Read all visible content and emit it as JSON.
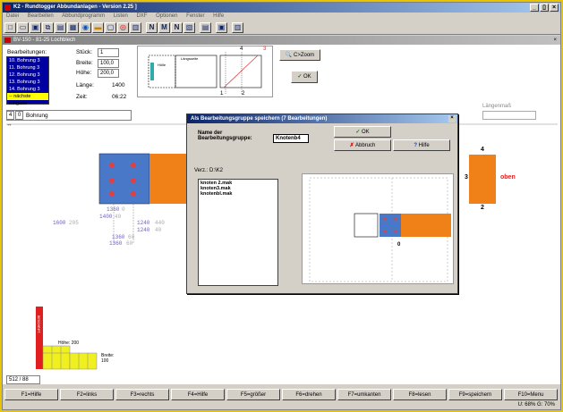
{
  "window": {
    "title": "K2 - Rundtogger Abbundanlagen - Version 2.25 ]",
    "controls": [
      "_",
      "▯",
      "×"
    ]
  },
  "menu": [
    "Datei",
    "Bearbeiten",
    "Abbundprogramm",
    "Listen",
    "DXF",
    "Optionen",
    "Fenster",
    "Hilfe"
  ],
  "toolbar_icons": [
    "new-icon",
    "open-icon",
    "save-icon",
    "copy-icon",
    "print-icon",
    "paste-icon",
    "disk-icon",
    "flag-icon",
    "dot-icon",
    "n-icon",
    "m-icon",
    "grid-icon",
    "split-icon",
    "box-icon",
    "doc-icon",
    "cut-icon"
  ],
  "sub_window": {
    "title": "BV-150 - 81-25 Lochblech"
  },
  "processing": {
    "label": "Bearbeitungen:",
    "items": [
      "10. Bohrung 3",
      "11. Bohrung 3",
      "12. Bohrung 3",
      "13. Bohrung 3",
      "14. Bohrung 3"
    ],
    "next_label": "-- nächste Eingabe --",
    "stk_label": "Stück:",
    "stk_value": "1",
    "breite_label": "Breite:",
    "breite_value": "100,0",
    "hoehe_label": "Höhe:",
    "hoehe_value": "200,0",
    "laenge_label": "Länge:",
    "laenge_value": "1400",
    "zeit_label": "Zeit:",
    "zeit_value": "06:22",
    "op_num": "4",
    "op_num2": "0",
    "op_name": "Bohrung",
    "laengenmass": "Längenmaß"
  },
  "preview": {
    "numbers": [
      "4",
      "3",
      "1",
      "2"
    ],
    "inset_label": "Hölle",
    "box_label": "Längsseite"
  },
  "buttons": {
    "zoom": "C>Zoom",
    "ok": "OK"
  },
  "dialog": {
    "title": "Als Bearbeitungsgruppe speichern (7 Bearbeitungen)",
    "name_label": "Name der Bearbeitungsgruppe:",
    "name_value": "Knotenb4",
    "ok": "OK",
    "cancel": "Abbruch",
    "help": "Hilfe",
    "dir_label": "Verz.: D:\\K2",
    "files": [
      "knoten 2.mak",
      "knoten3.mak",
      "knotenbl.mak"
    ],
    "preview_zero": "0"
  },
  "drawing": {
    "dims": [
      "1600",
      "205",
      "1360",
      "0",
      "1400",
      "40",
      "1240",
      "440",
      "1240",
      "40",
      "1360",
      "60",
      "1360",
      "60"
    ],
    "side_labels": [
      "4",
      "3",
      "2",
      "oben"
    ],
    "bar_label_h": "Höhe: 200",
    "bar_label_b": "Breite: 100",
    "bar_side_text": "BESCHRIFT."
  },
  "page_indicator": "512 / 88",
  "fkeys": [
    "F1=Hilfe",
    "F2=links",
    "F3=rechts",
    "F4=Hilfe",
    "F5=größer",
    "F6=drehen",
    "F7=umkanten",
    "F8=lesen",
    "F9=speichern",
    "F10=Menu"
  ],
  "status_right": "U: 68% G: 70%"
}
